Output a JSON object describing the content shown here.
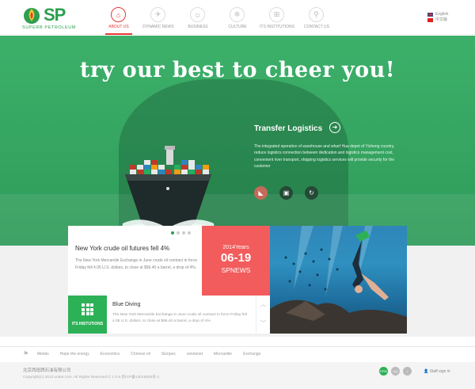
{
  "brand": {
    "name": "SP",
    "subtitle": "SUPERB PETROLEUM",
    "color": "#2e9e4f"
  },
  "nav": {
    "items": [
      {
        "label": "ABOUT US",
        "icon": "home-icon",
        "glyph": "⌂",
        "active": true
      },
      {
        "label": "DYNAMIC NEWS",
        "icon": "plane-icon",
        "glyph": "✈",
        "active": false
      },
      {
        "label": "BUSINESS",
        "icon": "business-icon",
        "glyph": "☺",
        "active": false
      },
      {
        "label": "CULTURE",
        "icon": "gear-icon",
        "glyph": "✲",
        "active": false
      },
      {
        "label": "ITS INSTITUTIONS",
        "icon": "grid-icon",
        "glyph": "⊞",
        "active": false
      },
      {
        "label": "CONTACT US",
        "icon": "location-icon",
        "glyph": "⚲",
        "active": false
      }
    ],
    "accent": "#e53935"
  },
  "lang": {
    "english": "English",
    "chinese": "中文版"
  },
  "hero": {
    "title": "try our best to cheer you!",
    "subtitle": "Transfer Logistics",
    "description": "The integrated operation of warehouse and wharf Hua depot of Yizheng country, reduce logistics connection between dedication and logistics management cost, convenient river transport, shipping logistics services will provide security for the customer",
    "buttons": [
      {
        "icon": "truck-icon",
        "glyph": "◣"
      },
      {
        "icon": "image-icon",
        "glyph": "▣"
      },
      {
        "icon": "refresh-icon",
        "glyph": "↻"
      }
    ]
  },
  "news": {
    "title": "New York crude oil futures fell 4%",
    "text": "The New York Mercantile Exchange in June crude oil contract in force Friday fell 4.05 U.S. dollars, to close at $96.40 a barrel, a drop of 4%.",
    "slides": 4,
    "active_slide": 0
  },
  "date_card": {
    "year": "2014Years",
    "day": "06-19",
    "source": "SPNEWS"
  },
  "institutions": {
    "label": "ITS INSTUTIONS"
  },
  "dive": {
    "title": "Blue Diving",
    "text": "The New York Mercantile Exchange in June crude oil contract in force Friday fell 4.05 U.S. dollars, to close at $96.40 a barrel, a drop of 4%.",
    "up": "︿",
    "down": "﹀"
  },
  "tags": [
    "Metals",
    "Hope the energy",
    "Economics",
    "Chinese oil",
    "Sinopec",
    "sinolanet",
    "Mercantile",
    "Exchange"
  ],
  "footer": {
    "company": "北京西班牌石油有限公司",
    "copyright": "Copyright(c) 2013 unitar.com. All Rights Reserved.© 1.0.5.京ICP备13015845号-1",
    "social": [
      "EPM",
      "QQ",
      "♪"
    ],
    "staff": "Staff sign in"
  }
}
